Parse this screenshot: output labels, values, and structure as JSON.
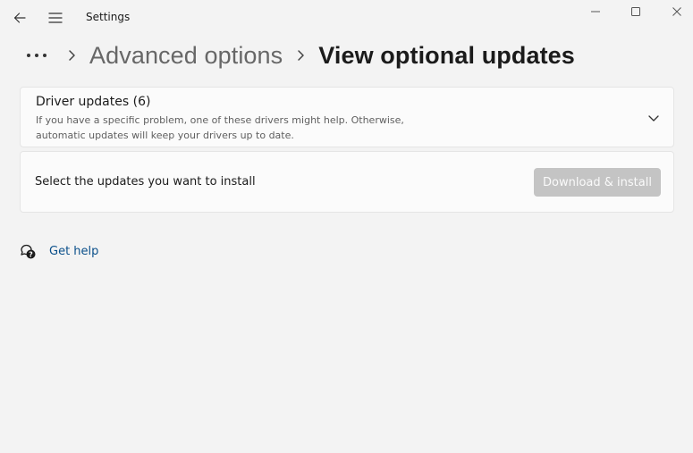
{
  "window": {
    "title": "Settings"
  },
  "breadcrumb": {
    "items": [
      "Advanced options",
      "View optional updates"
    ]
  },
  "driver_updates": {
    "title": "Driver updates (6)",
    "description": "If you have a specific problem, one of these drivers might help. Otherwise, automatic updates will keep your drivers up to date."
  },
  "install_section": {
    "label": "Select the updates you want to install",
    "button_label": "Download & install"
  },
  "help": {
    "label": "Get help"
  },
  "icons": {
    "back": "back-arrow-icon",
    "menu": "hamburger-menu-icon",
    "minimize": "minimize-icon",
    "maximize": "maximize-icon",
    "close": "close-icon",
    "more": "more-dots-icon",
    "separator": "chevron-right-icon",
    "expand": "chevron-down-icon",
    "help": "help-chat-icon"
  },
  "colors": {
    "background": "#f3f3f3",
    "card": "#fbfbfb",
    "link": "#0a4f8a",
    "button_disabled": "#c4c4c4"
  }
}
